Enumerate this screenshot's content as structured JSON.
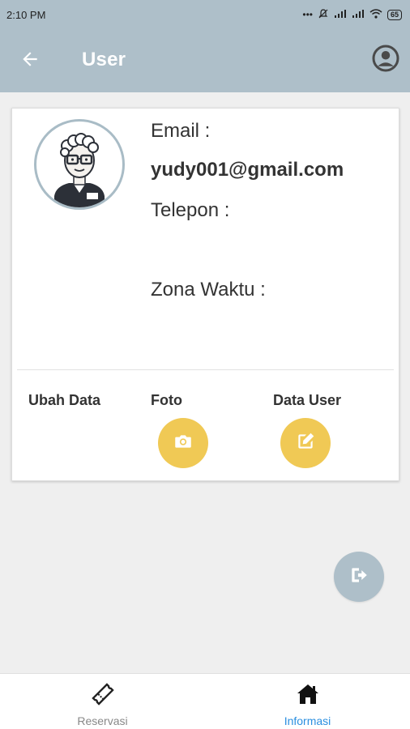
{
  "status_bar": {
    "time": "2:10 PM",
    "icons": [
      "dots-icon",
      "mute-icon",
      "signal-icon",
      "signal-icon",
      "wifi-icon",
      "battery-icon"
    ],
    "battery": "65"
  },
  "app_bar": {
    "title": "User",
    "back_icon": "arrow-left-icon",
    "account_icon": "account-circle-icon",
    "color": "#aebfc9"
  },
  "profile": {
    "email_label": "Email :",
    "email_value": "yudy001@gmail.com",
    "phone_label": "Telepon :",
    "timezone_label": "Zona Waktu :"
  },
  "actions": {
    "edit_label": "Ubah Data",
    "photo_label": "Foto",
    "data_label": "Data User",
    "photo_icon": "camera-icon",
    "data_icon": "edit-icon",
    "button_color": "#f0c955"
  },
  "fab": {
    "icon": "logout-icon"
  },
  "bottom_nav": {
    "items": [
      {
        "label": "Reservasi",
        "icon": "ticket-icon",
        "active": false
      },
      {
        "label": "Informasi",
        "icon": "home-icon",
        "active": true
      }
    ],
    "active_color": "#2a8fe0"
  }
}
